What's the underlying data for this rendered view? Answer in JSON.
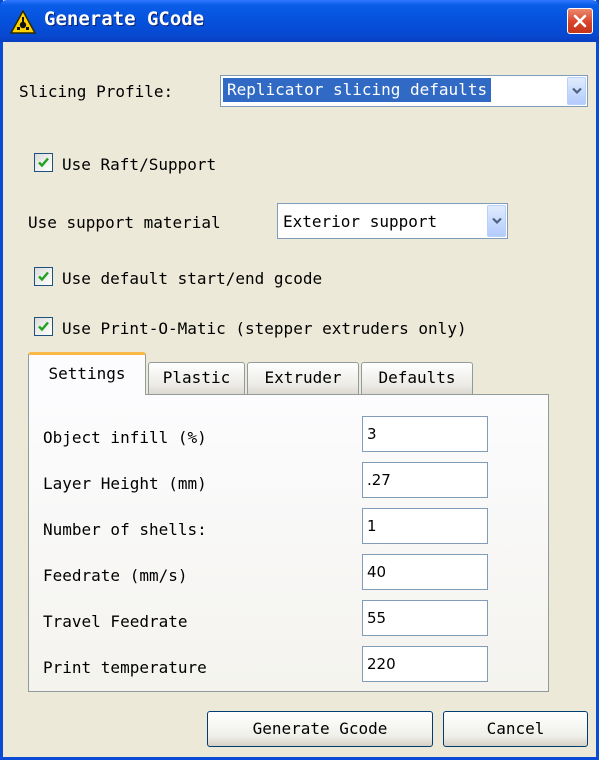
{
  "window": {
    "title": "Generate GCode",
    "icon": "warning-triangle-icon",
    "close_icon": "close-icon"
  },
  "slicing_profile": {
    "label": "Slicing Profile:",
    "value": "Replicator slicing defaults"
  },
  "use_raft": {
    "label": "Use Raft/Support",
    "checked": true
  },
  "support_material": {
    "label": "Use support material",
    "value": "Exterior support"
  },
  "use_default_gcode": {
    "label": "Use default start/end gcode",
    "checked": true
  },
  "use_print_o_matic": {
    "label": "Use Print-O-Matic (stepper extruders only)",
    "checked": true
  },
  "tabs": [
    {
      "label": "Settings",
      "active": true
    },
    {
      "label": "Plastic",
      "active": false
    },
    {
      "label": "Extruder",
      "active": false
    },
    {
      "label": "Defaults",
      "active": false
    }
  ],
  "settings": [
    {
      "label": "Object infill (%)",
      "value": "3"
    },
    {
      "label": "Layer Height (mm)",
      "value": ".27"
    },
    {
      "label": "Number of shells:",
      "value": "1"
    },
    {
      "label": "Feedrate (mm/s)",
      "value": "40"
    },
    {
      "label": "Travel Feedrate",
      "value": "55"
    },
    {
      "label": "Print temperature",
      "value": "220"
    }
  ],
  "buttons": {
    "generate": "Generate Gcode",
    "cancel": "Cancel"
  },
  "colors": {
    "titlebar": "#0551dc",
    "dialog_bg": "#ece9d8",
    "selection": "#316ac5",
    "tab_highlight": "#f9b946",
    "close_button": "#d8432a"
  }
}
